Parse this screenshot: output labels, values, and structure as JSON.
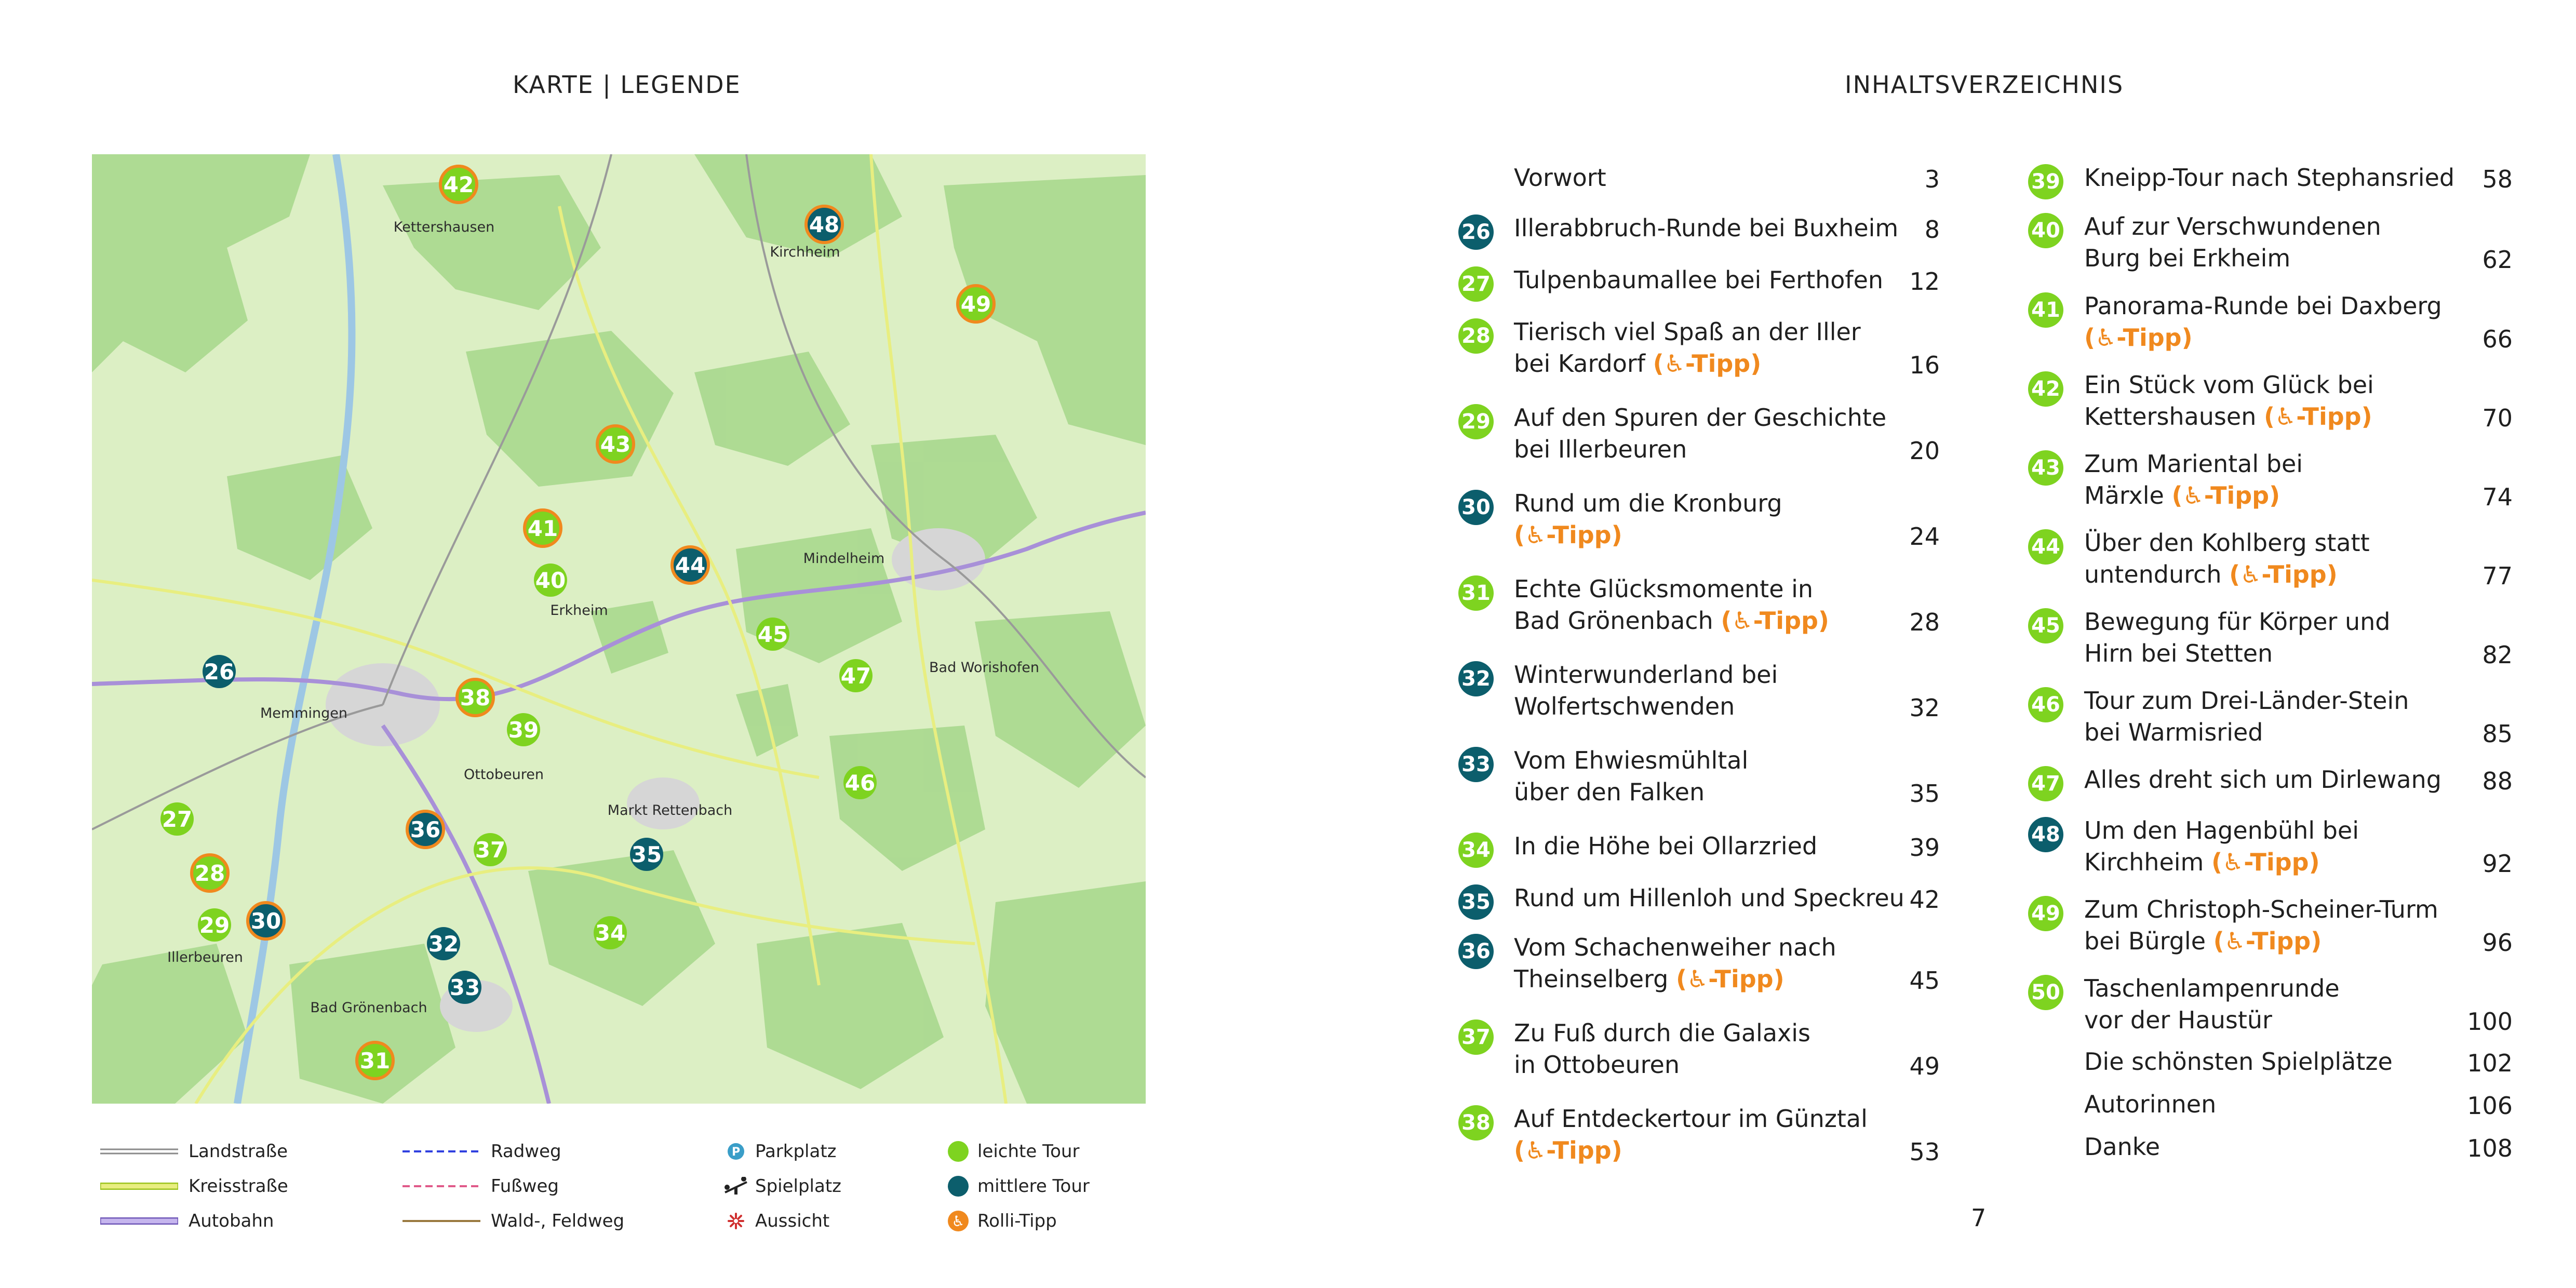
{
  "left_page": {
    "title": "KARTE | LEGENDE",
    "map": {
      "places": [
        {
          "name": "Kettershausen"
        },
        {
          "name": "Kirchheim"
        },
        {
          "name": "Mindelheim"
        },
        {
          "name": "Erkheim"
        },
        {
          "name": "Bad Worishofen"
        },
        {
          "name": "Memmingen"
        },
        {
          "name": "Ottobeuren"
        },
        {
          "name": "Markt Rettenbach"
        },
        {
          "name": "Illerbeuren"
        },
        {
          "name": "Bad Grönenbach"
        }
      ],
      "markers": [
        {
          "num": "42",
          "level": "easy",
          "rolli": true
        },
        {
          "num": "48",
          "level": "medium",
          "rolli": true
        },
        {
          "num": "49",
          "level": "easy",
          "rolli": true
        },
        {
          "num": "43",
          "level": "easy",
          "rolli": true
        },
        {
          "num": "41",
          "level": "easy",
          "rolli": true
        },
        {
          "num": "44",
          "level": "medium",
          "rolli": true
        },
        {
          "num": "40",
          "level": "easy",
          "rolli": false
        },
        {
          "num": "45",
          "level": "easy",
          "rolli": false
        },
        {
          "num": "47",
          "level": "easy",
          "rolli": false
        },
        {
          "num": "26",
          "level": "medium",
          "rolli": false
        },
        {
          "num": "38",
          "level": "easy",
          "rolli": true
        },
        {
          "num": "39",
          "level": "easy",
          "rolli": false
        },
        {
          "num": "46",
          "level": "easy",
          "rolli": false
        },
        {
          "num": "27",
          "level": "easy",
          "rolli": false
        },
        {
          "num": "36",
          "level": "medium",
          "rolli": true
        },
        {
          "num": "37",
          "level": "easy",
          "rolli": false
        },
        {
          "num": "35",
          "level": "medium",
          "rolli": false
        },
        {
          "num": "28",
          "level": "easy",
          "rolli": true
        },
        {
          "num": "29",
          "level": "easy",
          "rolli": false
        },
        {
          "num": "30",
          "level": "medium",
          "rolli": true
        },
        {
          "num": "32",
          "level": "medium",
          "rolli": false
        },
        {
          "num": "34",
          "level": "easy",
          "rolli": false
        },
        {
          "num": "33",
          "level": "medium",
          "rolli": false
        },
        {
          "num": "31",
          "level": "easy",
          "rolli": true
        }
      ]
    },
    "legend": {
      "landstrasse": "Landstraße",
      "kreisstrasse": "Kreisstraße",
      "autobahn": "Autobahn",
      "radweg": "Radweg",
      "fussweg": "Fußweg",
      "waldweg": "Wald-, Feldweg",
      "parkplatz": "Parkplatz",
      "spielplatz": "Spielplatz",
      "aussicht": "Aussicht",
      "leicht": "leichte Tour",
      "mittel": "mittlere Tour",
      "rolli": "Rolli-Tipp"
    },
    "colors": {
      "easy": "#7ed320",
      "medium": "#0c5e6c",
      "rolli": "#f0891e"
    }
  },
  "right_page": {
    "title": "INHALTSVERZEICHNIS",
    "page_number": "7",
    "tipp_label": "(♿-Tipp)",
    "col1": [
      {
        "num": "",
        "level": "",
        "line1": "Vorwort",
        "line2": "",
        "tipp": false,
        "page": "3"
      },
      {
        "num": "26",
        "level": "medium",
        "line1": "Illerabbruch-Runde bei Buxheim",
        "line2": "",
        "tipp": false,
        "page": "8"
      },
      {
        "num": "27",
        "level": "easy",
        "line1": "Tulpenbaumallee bei Ferthofen",
        "line2": "",
        "tipp": false,
        "page": "12"
      },
      {
        "num": "28",
        "level": "easy",
        "line1": "Tierisch viel Spaß an der Iller",
        "line2": "bei Kardorf",
        "tipp": true,
        "page": "16"
      },
      {
        "num": "29",
        "level": "easy",
        "line1": "Auf den Spuren der Geschichte",
        "line2": "bei Illerbeuren",
        "tipp": false,
        "page": "20"
      },
      {
        "num": "30",
        "level": "medium",
        "line1": "Rund um die Kronburg",
        "line2": "",
        "tipp": true,
        "page": "24"
      },
      {
        "num": "31",
        "level": "easy",
        "line1": "Echte Glücksmomente in",
        "line2": "Bad Grönenbach",
        "tipp": true,
        "page": "28"
      },
      {
        "num": "32",
        "level": "medium",
        "line1": "Winterwunderland bei",
        "line2": "Wolfertschwenden",
        "tipp": false,
        "page": "32"
      },
      {
        "num": "33",
        "level": "medium",
        "line1": "Vom Ehwiesmühltal",
        "line2": "über den Falken",
        "tipp": false,
        "page": "35"
      },
      {
        "num": "34",
        "level": "easy",
        "line1": "In die Höhe bei Ollarzried",
        "line2": "",
        "tipp": false,
        "page": "39"
      },
      {
        "num": "35",
        "level": "medium",
        "line1": "Rund um Hillenloh und Speckreu",
        "line2": "",
        "tipp": false,
        "page": "42"
      },
      {
        "num": "36",
        "level": "medium",
        "line1": "Vom Schachenweiher nach",
        "line2": "Theinselberg",
        "tipp": true,
        "page": "45"
      },
      {
        "num": "37",
        "level": "easy",
        "line1": "Zu Fuß durch die Galaxis",
        "line2": "in Ottobeuren",
        "tipp": false,
        "page": "49"
      },
      {
        "num": "38",
        "level": "easy",
        "line1": "Auf Entdeckertour im Günztal",
        "line2": "",
        "tipp": true,
        "page": "53"
      }
    ],
    "col2": [
      {
        "num": "39",
        "level": "easy",
        "line1": "Kneipp-Tour nach Stephansried",
        "line2": "",
        "tipp": false,
        "page": "58"
      },
      {
        "num": "40",
        "level": "easy",
        "line1": "Auf zur Verschwundenen",
        "line2": "Burg bei Erkheim",
        "tipp": false,
        "page": "62"
      },
      {
        "num": "41",
        "level": "easy",
        "line1": "Panorama-Runde bei Daxberg",
        "line2": "",
        "tipp": true,
        "page": "66"
      },
      {
        "num": "42",
        "level": "easy",
        "line1": "Ein Stück vom Glück bei",
        "line2": "Kettershausen",
        "tipp": true,
        "page": "70"
      },
      {
        "num": "43",
        "level": "easy",
        "line1": "Zum Mariental bei",
        "line2": "Märxle",
        "tipp": true,
        "page": "74"
      },
      {
        "num": "44",
        "level": "easy",
        "line1": "Über den Kohlberg statt",
        "line2": "untendurch",
        "tipp": true,
        "page": "77"
      },
      {
        "num": "45",
        "level": "easy",
        "line1": "Bewegung für Körper und",
        "line2": "Hirn bei Stetten",
        "tipp": false,
        "page": "82"
      },
      {
        "num": "46",
        "level": "easy",
        "line1": "Tour zum Drei-Länder-Stein",
        "line2": "bei Warmisried",
        "tipp": false,
        "page": "85"
      },
      {
        "num": "47",
        "level": "easy",
        "line1": "Alles dreht sich um Dirlewang",
        "line2": "",
        "tipp": false,
        "page": "88"
      },
      {
        "num": "48",
        "level": "medium",
        "line1": "Um den Hagenbühl bei",
        "line2": "Kirchheim",
        "tipp": true,
        "page": "92"
      },
      {
        "num": "49",
        "level": "easy",
        "line1": "Zum Christoph-Scheiner-Turm",
        "line2": "bei Bürgle",
        "tipp": true,
        "page": "96"
      },
      {
        "num": "50",
        "level": "easy",
        "line1": "Taschenlampenrunde",
        "line2": "vor der Haustür",
        "tipp": false,
        "page": "100"
      },
      {
        "num": "",
        "level": "",
        "line1": "Die schönsten Spielplätze",
        "line2": "",
        "tipp": false,
        "page": "102"
      },
      {
        "num": "",
        "level": "",
        "line1": "Autorinnen",
        "line2": "",
        "tipp": false,
        "page": "106"
      },
      {
        "num": "",
        "level": "",
        "line1": "Danke",
        "line2": "",
        "tipp": false,
        "page": "108"
      }
    ]
  }
}
